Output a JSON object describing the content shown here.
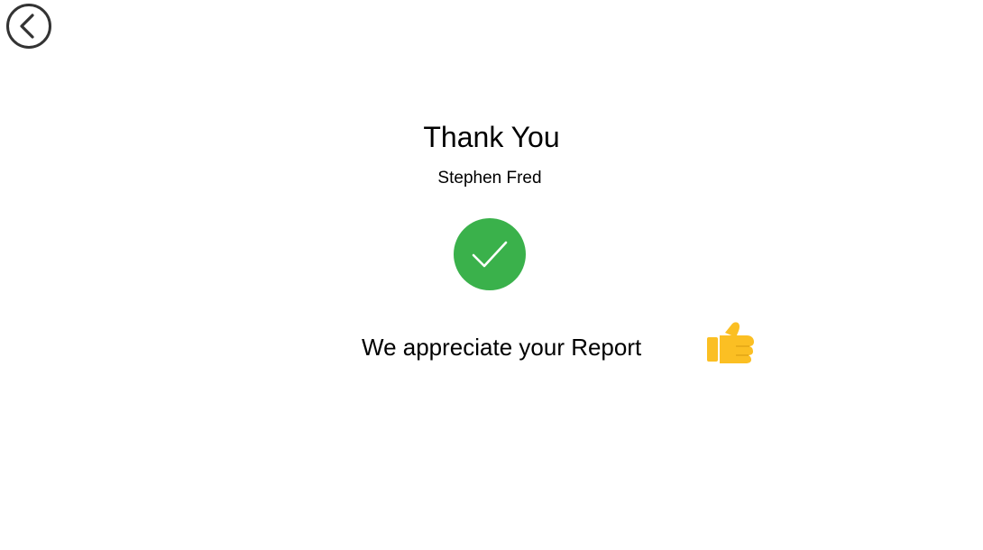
{
  "navigation": {
    "back_icon": "chevron-left-circle-icon"
  },
  "confirmation": {
    "title": "Thank You",
    "name": "Stephen Fred",
    "status_icon": "check-circle-icon",
    "message": "We appreciate your Report",
    "reaction_icon": "thumbs-up-icon"
  },
  "colors": {
    "success": "#3ab14b",
    "thumbs": "#fbbf23",
    "icon_stroke": "#333333"
  }
}
